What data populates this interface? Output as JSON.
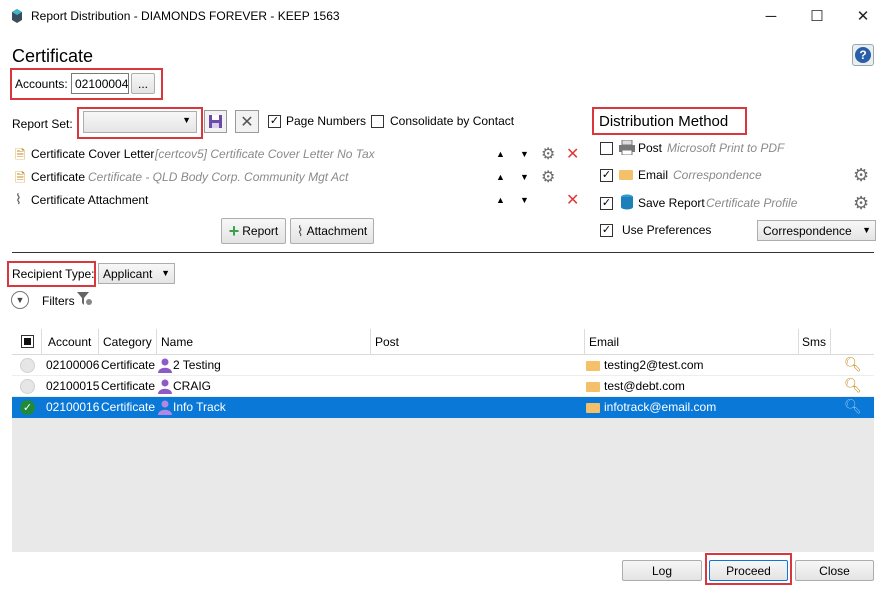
{
  "window": {
    "title": "Report Distribution - DIAMONDS FOREVER - KEEP 1563",
    "minimize": "─",
    "maximize": "☐",
    "close": "✕"
  },
  "header": {
    "title": "Certificate",
    "help": "?"
  },
  "accounts": {
    "label": "Accounts:",
    "value": "02100004",
    "browse": "..."
  },
  "report_set": {
    "label": "Report Set:",
    "value": "",
    "page_numbers": "Page Numbers",
    "page_numbers_checked": true,
    "consolidate": "Consolidate by Contact",
    "consolidate_checked": false
  },
  "reports": [
    {
      "name": "Certificate Cover Letter",
      "detail": "[certcov5] Certificate Cover Letter No Tax",
      "gear": true,
      "remove": true
    },
    {
      "name": "Certificate",
      "detail": "Certificate - QLD Body Corp. Community Mgt Act",
      "gear": true,
      "remove": false
    },
    {
      "name": "Certificate Attachment",
      "detail": "",
      "gear": false,
      "remove": true
    }
  ],
  "add_buttons": {
    "report": "Report",
    "attachment": "Attachment"
  },
  "distribution": {
    "title": "Distribution Method",
    "post": {
      "label": "Post",
      "detail": "Microsoft Print to PDF",
      "checked": false
    },
    "email": {
      "label": "Email",
      "detail": "Correspondence",
      "checked": true
    },
    "save": {
      "label": "Save Report",
      "detail": "Certificate Profile",
      "checked": true
    },
    "prefs": {
      "label": "Use Preferences",
      "checked": true,
      "select": "Correspondence"
    }
  },
  "recipient": {
    "label": "Recipient Type:",
    "value": "Applicant"
  },
  "filters": {
    "label": "Filters"
  },
  "grid": {
    "columns": [
      "Account",
      "Category",
      "Name",
      "Post",
      "Email",
      "Sms"
    ],
    "rows": [
      {
        "account": "02100006",
        "category": "Certificate",
        "name": "2 Testing",
        "post": "",
        "email": "testing2@test.com",
        "selected": false
      },
      {
        "account": "02100015",
        "category": "Certificate",
        "name": "CRAIG",
        "post": "",
        "email": "test@debt.com",
        "selected": false
      },
      {
        "account": "02100016",
        "category": "Certificate",
        "name": "Info Track",
        "post": "",
        "email": "infotrack@email.com",
        "selected": true
      }
    ]
  },
  "footer": {
    "log": "Log",
    "proceed": "Proceed",
    "close": "Close"
  },
  "colors": {
    "accent": "#0a78d7",
    "highlight_box": "#d9363e",
    "check_green": "#1f8a3a"
  }
}
